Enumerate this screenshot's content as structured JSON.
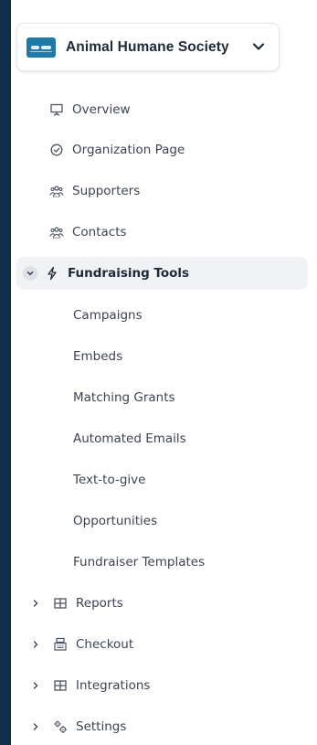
{
  "org": {
    "name": "Animal Humane Society"
  },
  "nav": {
    "overview": "Overview",
    "organization_page": "Organization Page",
    "supporters": "Supporters",
    "contacts": "Contacts",
    "fundraising_tools": "Fundraising Tools",
    "sub": {
      "campaigns": "Campaigns",
      "embeds": "Embeds",
      "matching_grants": "Matching Grants",
      "automated_emails": "Automated Emails",
      "text_to_give": "Text-to-give",
      "opportunities": "Opportunities",
      "fundraiser_templates": "Fundraiser Templates"
    },
    "reports": "Reports",
    "checkout": "Checkout",
    "integrations": "Integrations",
    "settings": "Settings"
  },
  "colors": {
    "background": "#0f2d4d",
    "panel": "#ffffff",
    "text": "#3b4452",
    "active_bg": "#f0f2f5"
  }
}
